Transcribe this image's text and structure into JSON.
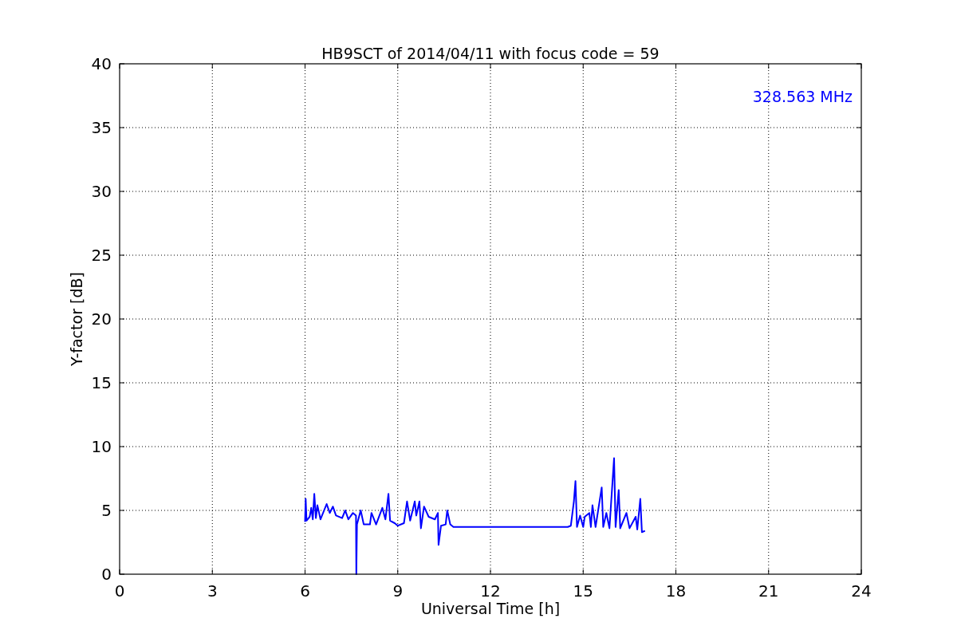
{
  "figure": {
    "chart_data": {
      "type": "line",
      "title": "HB9SCT of 2014/04/11 with focus code = 59",
      "xlabel": "Universal Time [h]",
      "ylabel": "Y-factor [dB]",
      "xlim": [
        0,
        24
      ],
      "ylim": [
        0,
        40
      ],
      "xticks": [
        0,
        3,
        6,
        9,
        12,
        15,
        18,
        21,
        24
      ],
      "yticks": [
        0,
        5,
        10,
        15,
        20,
        25,
        30,
        35,
        40
      ],
      "x": [
        6.0,
        6.02,
        6.05,
        6.15,
        6.2,
        6.25,
        6.3,
        6.35,
        6.4,
        6.5,
        6.7,
        6.8,
        6.9,
        7.0,
        7.2,
        7.3,
        7.4,
        7.55,
        7.65,
        7.66,
        7.68,
        7.8,
        7.9,
        8.1,
        8.15,
        8.3,
        8.5,
        8.6,
        8.7,
        8.75,
        8.9,
        9.0,
        9.2,
        9.3,
        9.4,
        9.55,
        9.6,
        9.7,
        9.75,
        9.85,
        10.0,
        10.2,
        10.3,
        10.32,
        10.4,
        10.55,
        10.6,
        10.7,
        10.8,
        14.5,
        14.6,
        14.7,
        14.75,
        14.8,
        14.9,
        15.0,
        15.05,
        15.2,
        15.25,
        15.3,
        15.4,
        15.6,
        15.65,
        15.75,
        15.85,
        16.0,
        16.05,
        16.15,
        16.2,
        16.4,
        16.5,
        16.7,
        16.75,
        16.85,
        16.9,
        17.0
      ],
      "series": [
        {
          "color": "#0000ff",
          "values": [
            4.1,
            5.9,
            4.2,
            4.5,
            5.2,
            4.3,
            6.3,
            4.4,
            5.4,
            4.3,
            5.5,
            4.8,
            5.3,
            4.6,
            4.4,
            5.0,
            4.3,
            4.8,
            4.6,
            0.0,
            3.9,
            5.0,
            3.9,
            3.9,
            4.8,
            3.9,
            5.2,
            4.3,
            6.3,
            4.2,
            4.0,
            3.8,
            4.0,
            5.7,
            4.2,
            5.7,
            4.6,
            5.7,
            3.6,
            5.3,
            4.5,
            4.3,
            4.8,
            2.3,
            3.8,
            3.9,
            5.0,
            3.9,
            3.7,
            3.7,
            3.8,
            5.7,
            7.3,
            3.7,
            4.6,
            3.7,
            4.5,
            4.8,
            3.7,
            5.4,
            3.7,
            6.8,
            3.7,
            4.8,
            3.6,
            9.1,
            3.7,
            6.6,
            3.6,
            4.8,
            3.6,
            4.5,
            3.5,
            5.9,
            3.3,
            3.4
          ]
        }
      ],
      "grid": true,
      "annotations": [
        {
          "text": "328.563 MHz"
        }
      ]
    }
  }
}
